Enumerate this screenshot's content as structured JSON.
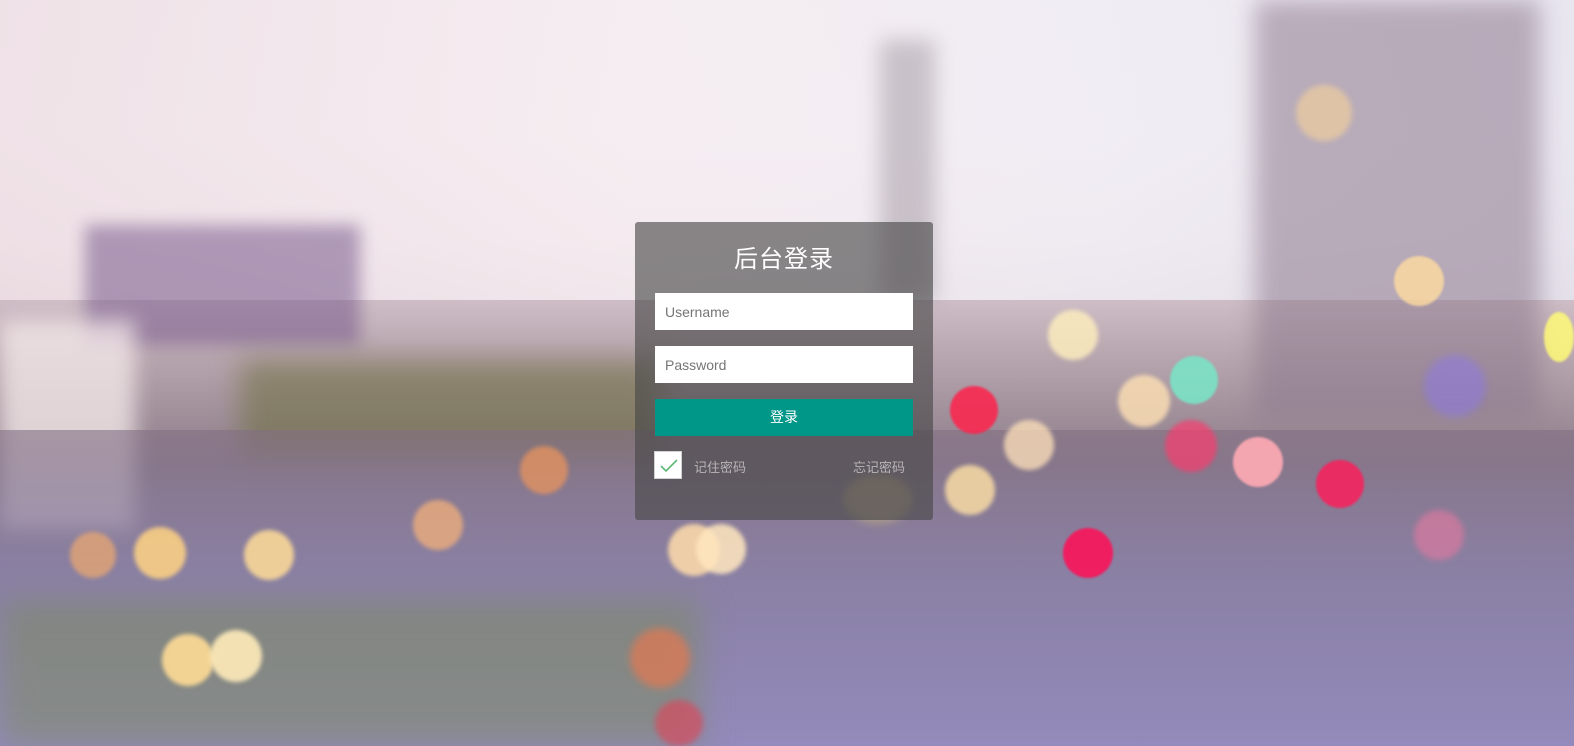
{
  "login": {
    "title": "后台登录",
    "username_placeholder": "Username",
    "password_placeholder": "Password",
    "submit_label": "登录",
    "remember_label": "记住密码",
    "remember_checked": true,
    "forgot_label": "忘记密码"
  },
  "colors": {
    "accent": "#009688",
    "panel_overlay": "rgba(70,70,70,0.62)",
    "secondary_text": "#b9b4b5"
  }
}
